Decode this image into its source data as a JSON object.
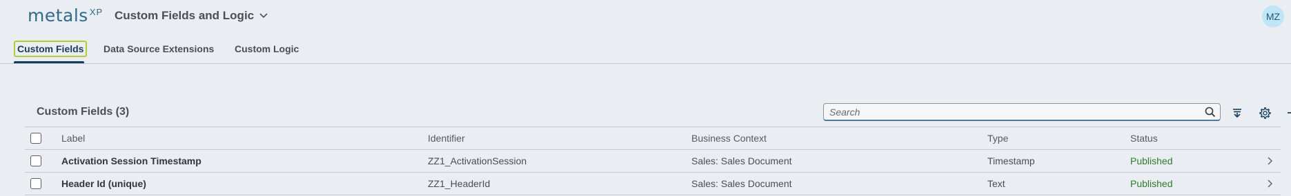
{
  "header": {
    "logo_text": "metals",
    "logo_sup": "XP",
    "app_title": "Custom Fields and Logic",
    "avatar_initials": "MZ"
  },
  "tabs": [
    {
      "label": "Custom Fields",
      "selected": true
    },
    {
      "label": "Data Source Extensions",
      "selected": false
    },
    {
      "label": "Custom Logic",
      "selected": false
    }
  ],
  "table": {
    "title": "Custom Fields (3)",
    "search_placeholder": "Search",
    "columns": {
      "label": "Label",
      "identifier": "Identifier",
      "business_context": "Business Context",
      "type": "Type",
      "status": "Status"
    },
    "rows": [
      {
        "label": "Activation Session Timestamp",
        "identifier": "ZZ1_ActivationSession",
        "business_context": "Sales: Sales Document",
        "type": "Timestamp",
        "status": "Published"
      },
      {
        "label": "Header Id (unique)",
        "identifier": "ZZ1_HeaderId",
        "business_context": "Sales: Sales Document",
        "type": "Text",
        "status": "Published"
      }
    ]
  },
  "icons": {
    "dropdown": "chevron-down-icon",
    "search": "search-icon",
    "sort": "sort-icon",
    "settings": "gear-icon",
    "add": "add-icon",
    "row_nav": "chevron-right-icon"
  },
  "colors": {
    "background": "#eaedf1",
    "accent": "#0e3d5e",
    "status_published": "#2b7d2b",
    "focus_outline": "#b6cc2c"
  }
}
